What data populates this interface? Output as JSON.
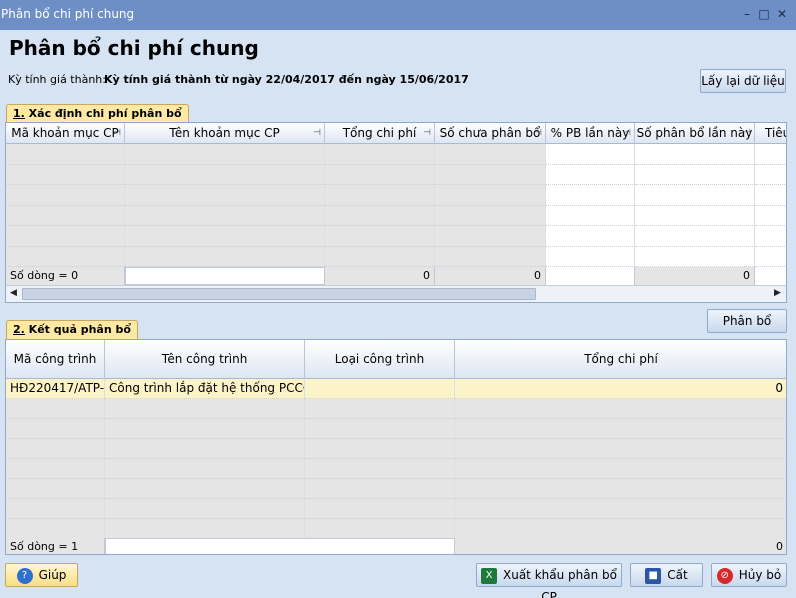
{
  "window": {
    "title": "Phân bổ chi phí chung"
  },
  "page_title": "Phân bổ chi phí chung",
  "ky": {
    "label": "Kỳ tính giá thành:",
    "value": "Kỳ tính giá thành từ ngày 22/04/2017 đến ngày 15/06/2017"
  },
  "reload_button": "Lấy lại dữ liệu",
  "section1": {
    "tab_number": "1.",
    "tab_text": " Xác định chi phí phân bổ",
    "columns": [
      "Mã khoản mục CP",
      "Tên khoản mục CP",
      "Tổng chi phí",
      "Số chưa phân bổ",
      "% PB lần này",
      "Số phân bổ lần này",
      "Tiêu"
    ],
    "footer": {
      "rowcount": "Số dòng = 0",
      "tong": "0",
      "chua": "0",
      "phanbo": "0"
    }
  },
  "allocate_button": "Phân bổ",
  "section2": {
    "tab_number": "2.",
    "tab_text": " Kết quả phân bổ",
    "columns": [
      "Mã công trình",
      "Tên công trình",
      "Loại công trình",
      "Tổng chi phí"
    ],
    "rows": [
      {
        "ma": "HĐ220417/ATP-",
        "ten": "Công trình lắp đặt hệ thống PCCC - A",
        "loai": "",
        "tong": "0"
      }
    ],
    "footer": {
      "rowcount": "Số dòng = 1",
      "tong": "0"
    }
  },
  "buttons": {
    "help": "Giúp",
    "export": "Xuất khẩu phân bổ CP",
    "save": "Cất",
    "cancel": "Hủy bỏ"
  }
}
